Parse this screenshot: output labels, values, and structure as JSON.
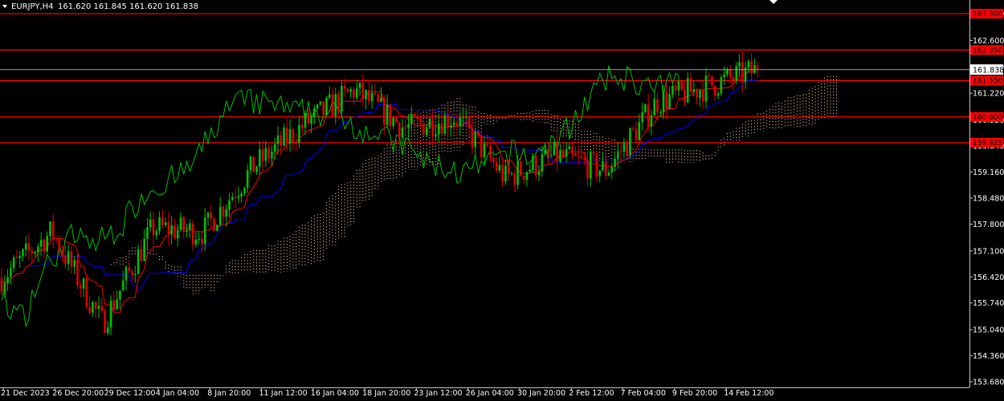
{
  "chart_data": {
    "type": "candlestick",
    "symbol_label": "EURJPY,H4",
    "ohlc_label": "161.620 161.845 161.620 161.838",
    "current_price": 161.838,
    "y_ticks": [
      "163.300",
      "162.600",
      "161.900",
      "161.220",
      "160.520",
      "159.840",
      "159.160",
      "158.480",
      "157.800",
      "157.100",
      "156.420",
      "155.740",
      "155.040",
      "154.360",
      "153.680"
    ],
    "ylim": [
      153.68,
      163.3
    ],
    "x_ticks": [
      "21 Dec 2023",
      "26 Dec 20:00",
      "29 Dec 12:00",
      "4 Jan 04:00",
      "8 Jan 20:00",
      "11 Jan 12:00",
      "16 Jan 04:00",
      "18 Jan 20:00",
      "23 Jan 12:00",
      "26 Jan 04:00",
      "30 Jan 20:00",
      "2 Feb 12:00",
      "7 Feb 04:00",
      "9 Feb 20:00",
      "14 Feb 12:00"
    ],
    "levels": [
      {
        "label": "163.300",
        "value": 163.3
      },
      {
        "label": "162.350",
        "value": 162.35
      },
      {
        "label": "161.550",
        "value": 161.55
      },
      {
        "label": "160.600",
        "value": 160.6
      },
      {
        "label": "159.925",
        "value": 159.925
      }
    ],
    "key_closes": [
      {
        "x": "21 Dec 2023",
        "close": 156.4
      },
      {
        "x": "26 Dec 20:00",
        "close": 157.6
      },
      {
        "x": "29 Dec 12:00",
        "close": 155.2
      },
      {
        "x": "4 Jan 04:00",
        "close": 157.7
      },
      {
        "x": "8 Jan 20:00",
        "close": 157.6
      },
      {
        "x": "11 Jan 12:00",
        "close": 159.3
      },
      {
        "x": "16 Jan 04:00",
        "close": 160.4
      },
      {
        "x": "18 Jan 20:00",
        "close": 161.3
      },
      {
        "x": "23 Jan 12:00",
        "close": 160.3
      },
      {
        "x": "26 Jan 04:00",
        "close": 160.6
      },
      {
        "x": "30 Jan 20:00",
        "close": 159.0
      },
      {
        "x": "2 Feb 12:00",
        "close": 159.6
      },
      {
        "x": "7 Feb 04:00",
        "close": 159.2
      },
      {
        "x": "9 Feb 20:00",
        "close": 161.0
      },
      {
        "x": "14 Feb 12:00",
        "close": 161.4
      },
      {
        "x": "15 Feb 12:00",
        "close": 161.838
      }
    ],
    "colors": {
      "background": "#000000",
      "bull": "#00c000",
      "bear": "#e00000",
      "level_line": "#ff0000",
      "tenkan": "#ff0000",
      "kijun": "#0000ff",
      "chikou": "#00c000",
      "cloud_dots": "#f4c8a0",
      "text": "#ffffff"
    },
    "legend": "none",
    "grid": false
  }
}
